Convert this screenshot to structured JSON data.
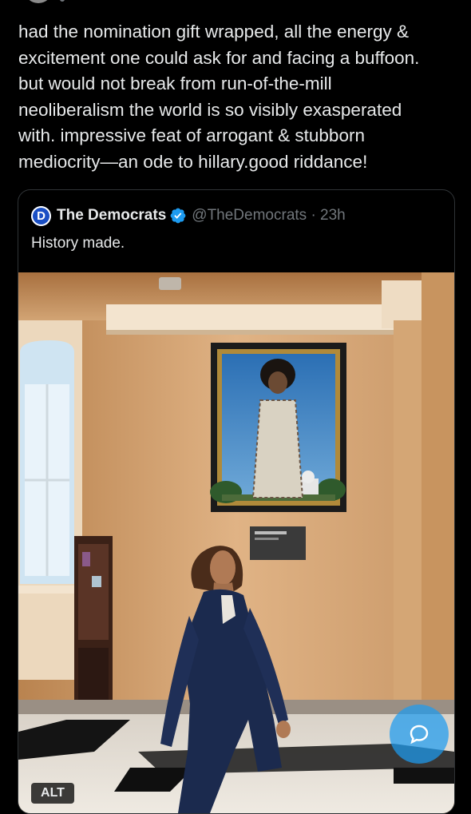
{
  "post": {
    "text": "had the nomination gift wrapped, all the energy &\nexcitement one could ask for and facing a buffoon.\nbut would not break from run-of-the-mill\nneoliberalism the world is so visibly exasperated\nwith. impressive feat of arrogant & stubborn\nmediocrity—an ode to hillary.good riddance!"
  },
  "quote": {
    "logo_letter": "D",
    "name": "The Democrats",
    "handle_meta": "@TheDemocrats · 23h",
    "text": "History made.",
    "media_alt_label": "ALT"
  },
  "colors": {
    "background": "#000000",
    "text": "#e7e9ea",
    "muted": "#71767b",
    "border": "#2f3336",
    "verified": "#1d9bf0",
    "accent": "#1d9bf0"
  },
  "icons": [
    "verified-badge-icon",
    "democrats-logo",
    "reply-icon"
  ]
}
